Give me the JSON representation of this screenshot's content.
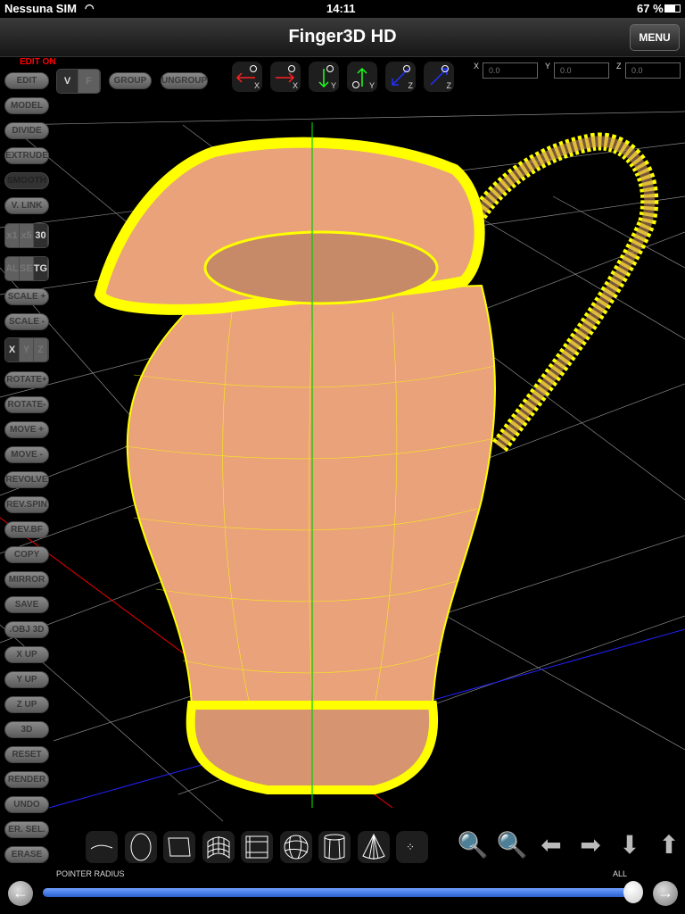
{
  "status": {
    "carrier": "Nessuna SIM",
    "time": "14:11",
    "battery": "67 %"
  },
  "navbar": {
    "title": "Finger3D HD",
    "menu": "MENU"
  },
  "edit_status": "EDIT ON",
  "top_buttons": {
    "edit": "EDIT",
    "v": "V",
    "f": "F",
    "group": "GROUP",
    "ungroup": "UNGROUP"
  },
  "side_buttons": [
    "MODEL",
    "DIVIDE",
    "EXTRUDE",
    "SMOOTH",
    "V. LINK"
  ],
  "step_seg": [
    "x1",
    "x5",
    "30"
  ],
  "mode_seg": [
    "AL",
    "SE",
    "TG"
  ],
  "side_buttons2": [
    "SCALE +",
    "SCALE -"
  ],
  "axis_seg": [
    "X",
    "Y",
    "Z"
  ],
  "side_buttons3": [
    "ROTATE+",
    "ROTATE-",
    "MOVE +",
    "MOVE -",
    "REVOLVE",
    "REV.SPIN",
    "REV.BF",
    "COPY",
    "MIRROR",
    "SAVE",
    ".OBJ 3D",
    "X UP",
    "Y UP",
    "Z UP",
    "3D",
    "RESET",
    "RENDER",
    "UNDO",
    "ER. SEL.",
    "ERASE"
  ],
  "axis_buttons": [
    {
      "label": "X",
      "dir": "left",
      "color": "#ff2020"
    },
    {
      "label": "X",
      "dir": "right",
      "color": "#ff2020"
    },
    {
      "label": "Y",
      "dir": "down",
      "color": "#20ff20"
    },
    {
      "label": "Y",
      "dir": "up",
      "color": "#20ff20"
    },
    {
      "label": "Z",
      "dir": "in",
      "color": "#2030ff"
    },
    {
      "label": "Z",
      "dir": "out",
      "color": "#2030ff"
    }
  ],
  "coords": {
    "x_label": "X",
    "x": "0.0",
    "y_label": "Y",
    "y": "0.0",
    "z_label": "Z",
    "z": "0.0"
  },
  "tools": [
    "curve",
    "circle",
    "plane",
    "grid-surface",
    "box",
    "sphere",
    "cylinder",
    "cone",
    "points"
  ],
  "nav_icons": [
    "zoom-in",
    "zoom-out",
    "arrow-left",
    "arrow-right",
    "arrow-down",
    "arrow-up"
  ],
  "slider": {
    "label": "POINTER RADIUS",
    "value_label": "ALL",
    "value": 1.0
  },
  "colors": {
    "mesh": "#ffff00",
    "surface": "#e9a27a",
    "x_axis": "#ff0000",
    "y_axis": "#00cc00",
    "z_axis": "#0000ff"
  }
}
